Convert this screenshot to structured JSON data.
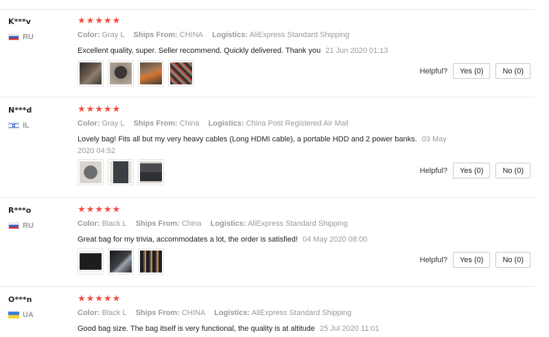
{
  "star_glyph": "★",
  "helpful_label": "Helpful?",
  "labels": {
    "color": "Color:",
    "ships_from": "Ships From:",
    "logistics": "Logistics:"
  },
  "reviews": [
    {
      "user": "K***v",
      "country": "RU",
      "flag_icon": "russia-flag-icon",
      "rating": 5,
      "color": "Gray L",
      "ships_from": "CHINA",
      "logistics": "AliExpress Standard Shipping",
      "text": "Excellent quality, super. Seller recommend. Quickly delivered. Thank you",
      "date": "21 Jun 2020 01:13",
      "yes_label": "Yes (0)",
      "no_label": "No (0)",
      "photos": [
        "photo-bag-open",
        "photo-bag-front",
        "photo-bag-orange",
        "photo-bag-cables"
      ]
    },
    {
      "user": "N***d",
      "country": "IL",
      "flag_icon": "israel-flag-icon",
      "rating": 5,
      "color": "Gray L",
      "ships_from": "China",
      "logistics": "China Post Registered Air Mail",
      "text": "Lovely bag! Fits all but my very heavy cables (Long HDMI cable), a portable HDD and 2 power banks.",
      "date": "03 May 2020 04:52",
      "yes_label": "Yes (0)",
      "no_label": "No (0)",
      "photos": [
        "photo-bag-closed",
        "photo-bag-inside",
        "photo-bag-filled"
      ]
    },
    {
      "user": "R***o",
      "country": "RU",
      "flag_icon": "russia-flag-icon",
      "rating": 5,
      "color": "Black L",
      "ships_from": "China",
      "logistics": "AliExpress Standard Shipping",
      "text": "Great bag for my trivia, accommodates a lot, the order is satisfied!",
      "date": "04 May 2020 08:00",
      "yes_label": "Yes (0)",
      "no_label": "No (0)",
      "photos": [
        "photo-black-bag-front",
        "photo-black-bag-open",
        "photo-black-bag-items"
      ]
    },
    {
      "user": "O***n",
      "country": "UA",
      "flag_icon": "ukraine-flag-icon",
      "rating": 5,
      "color": "Black L",
      "ships_from": "CHINA",
      "logistics": "AliExpress Standard Shipping",
      "text": "Good bag size. The bag itself is very functional, the quality is at altitude",
      "date": "25 Jul 2020 11:01"
    }
  ]
}
